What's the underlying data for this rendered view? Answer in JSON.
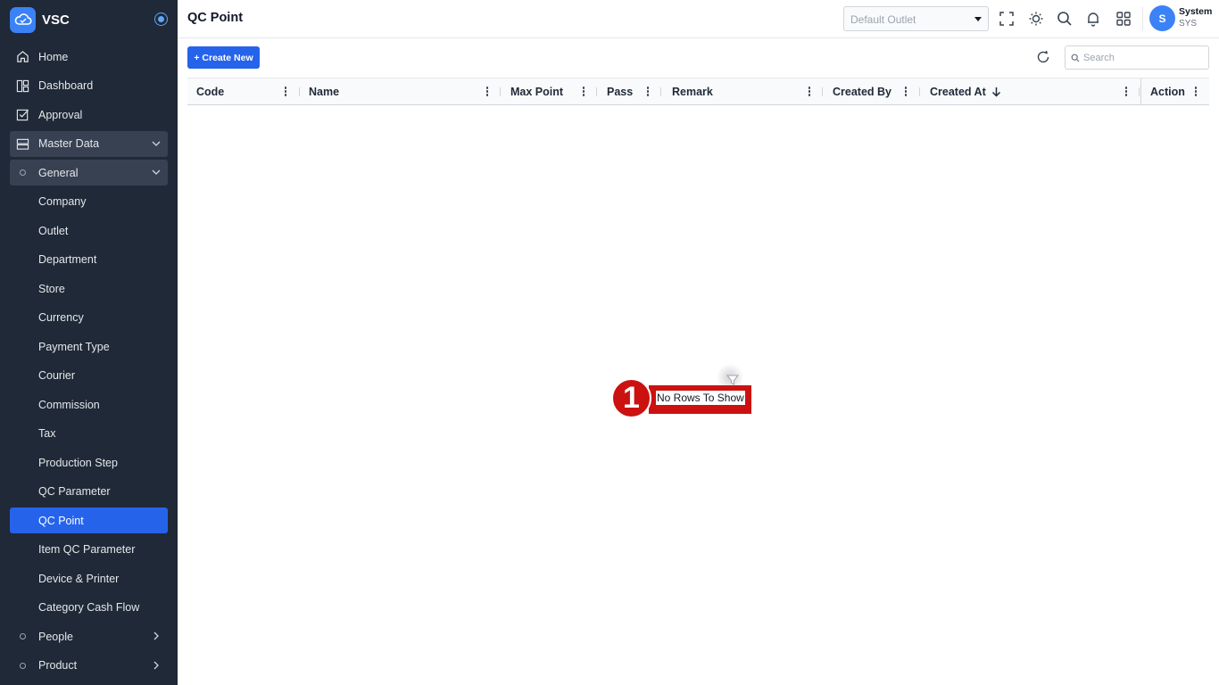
{
  "app": {
    "name": "VSC"
  },
  "sidebar": {
    "items": [
      {
        "label": "Home",
        "icon": "home-icon"
      },
      {
        "label": "Dashboard",
        "icon": "dashboard-icon"
      },
      {
        "label": "Approval",
        "icon": "approval-icon"
      },
      {
        "label": "Master Data",
        "icon": "master-data-icon"
      },
      {
        "label": "General"
      },
      {
        "label": "Company"
      },
      {
        "label": "Outlet"
      },
      {
        "label": "Department"
      },
      {
        "label": "Store"
      },
      {
        "label": "Currency"
      },
      {
        "label": "Payment Type"
      },
      {
        "label": "Courier"
      },
      {
        "label": "Commission"
      },
      {
        "label": "Tax"
      },
      {
        "label": "Production Step"
      },
      {
        "label": "QC Parameter"
      },
      {
        "label": "QC Point"
      },
      {
        "label": "Item QC Parameter"
      },
      {
        "label": "Device & Printer"
      },
      {
        "label": "Category Cash Flow"
      },
      {
        "label": "People"
      },
      {
        "label": "Product"
      }
    ]
  },
  "header": {
    "title": "QC Point",
    "outlet_placeholder": "Default Outlet",
    "user": {
      "initial": "S",
      "name": "System",
      "code": "SYS"
    }
  },
  "toolbar": {
    "create_label": "+ Create New",
    "search_placeholder": "Search"
  },
  "grid": {
    "columns": [
      "Code",
      "Name",
      "Max Point",
      "Pass",
      "Remark",
      "Created By",
      "Created At",
      "Action"
    ],
    "empty_message": "No Rows To Show"
  },
  "annotation": {
    "marker": "1"
  },
  "colors": {
    "sidebar_bg": "#1f2937",
    "accent": "#2563eb",
    "marker": "#cc1111"
  }
}
